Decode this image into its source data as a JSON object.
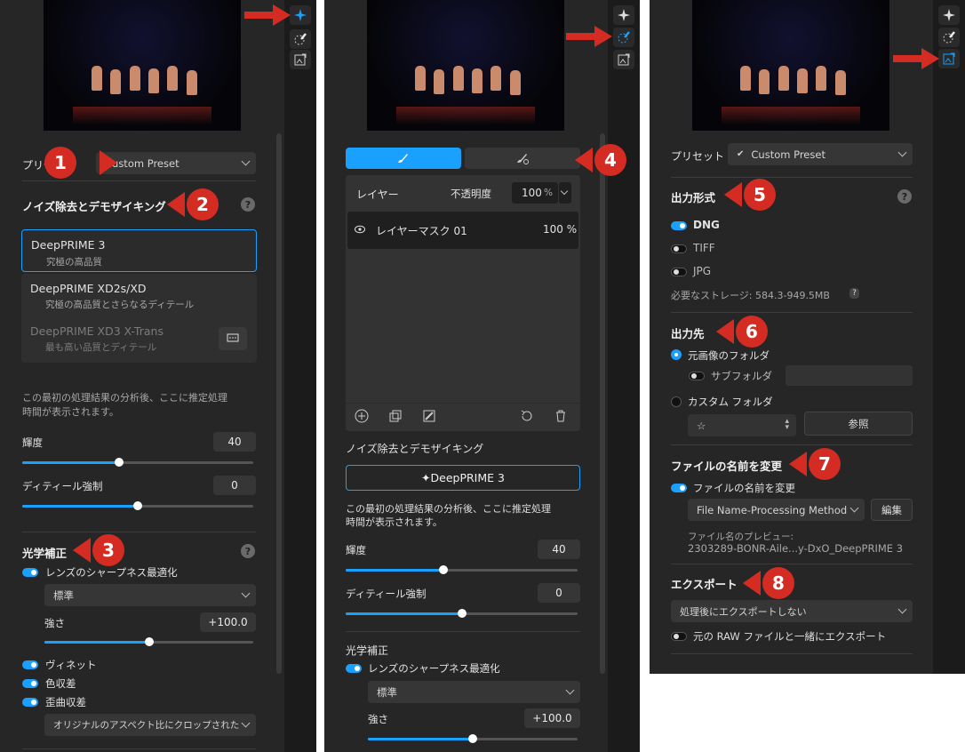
{
  "icons": {
    "ai_wand": "sparkle-wand-icon",
    "local_adjust": "brush-circle-icon",
    "export": "export-image-icon"
  },
  "panel1": {
    "preset": {
      "label": "プリセット",
      "value": "Custom Preset"
    },
    "noise": {
      "title": "ノイズ除去とデモザイキング",
      "models": [
        {
          "name": "DeepPRIME 3",
          "desc": "究極の高品質"
        },
        {
          "name": "DeepPRIME XD2s/XD",
          "desc": "究極の高品質とさらなるディテール"
        },
        {
          "name": "DeepPRIME XD3 X-Trans",
          "desc": "最も高い品質とディテール"
        }
      ],
      "estimate": "この最初の処理結果の分析後、ここに推定処理\n時間が表示されます。",
      "luminance": {
        "label": "輝度",
        "value": "40",
        "level": 0.42
      },
      "detail": {
        "label": "ディティール強制",
        "value": "0",
        "level": 0.5
      }
    },
    "optics": {
      "title": "光学補正",
      "lens_sharpness": "レンズのシャープネス最適化",
      "mode": "標準",
      "strength": {
        "label": "強さ",
        "value": "+100.0",
        "level": 0.5
      },
      "vignette": "ヴィネット",
      "chromatic": "色収差",
      "distortion": "歪曲収差",
      "crop": "オリジナルのアスペクト比にクロップされた"
    }
  },
  "panel2": {
    "layers": {
      "header": "レイヤー",
      "opacity_label": "不透明度",
      "opacity_value": "100",
      "opacity_unit": "%",
      "mask_name": "レイヤーマスク 01",
      "mask_opacity": "100 %"
    },
    "noise": {
      "title": "ノイズ除去とデモザイキング",
      "button": "✦DeepPRIME 3",
      "estimate": "この最初の処理結果の分析後、ここに推定処理\n時間が表示されます。",
      "luminance": {
        "label": "輝度",
        "value": "40",
        "level": 0.42
      },
      "detail": {
        "label": "ディティール強制",
        "value": "0",
        "level": 0.5
      }
    },
    "optics": {
      "title": "光学補正",
      "lens_sharpness": "レンズのシャープネス最適化",
      "mode": "標準",
      "strength": {
        "label": "強さ",
        "value": "+100.0",
        "level": 0.5
      }
    }
  },
  "panel3": {
    "preset": {
      "label": "プリセット",
      "value": "Custom Preset"
    },
    "format": {
      "title": "出力形式",
      "options": [
        "DNG",
        "TIFF",
        "JPG"
      ],
      "storage": "必要なストレージ: 584.3-949.5MB",
      "storage_q": "?"
    },
    "destination": {
      "title": "出力先",
      "original": "元画像のフォルダ",
      "subfolder": "サブフォルダ",
      "custom": "カスタム フォルダ",
      "custom_value": "☆",
      "browse": "参照"
    },
    "rename": {
      "title": "ファイルの名前を変更",
      "toggle_label": "ファイルの名前を変更",
      "pattern": "File Name-Processing Method",
      "edit": "編集",
      "preview_label": "ファイル名のプレビュー:",
      "preview_value": "2303289-BONR-Aile...y-DxO_DeepPRIME 3"
    },
    "export": {
      "title": "エクスポート",
      "option": "処理後にエクスポートしない",
      "raw_toggle": "元の RAW ファイルと一緒にエクスポート"
    }
  },
  "callouts": [
    "1",
    "2",
    "3",
    "4",
    "5",
    "6",
    "7",
    "8"
  ],
  "help": "?",
  "colors": {
    "accent": "#1aa0ff",
    "callout": "#d42c22",
    "panel": "#262626"
  }
}
